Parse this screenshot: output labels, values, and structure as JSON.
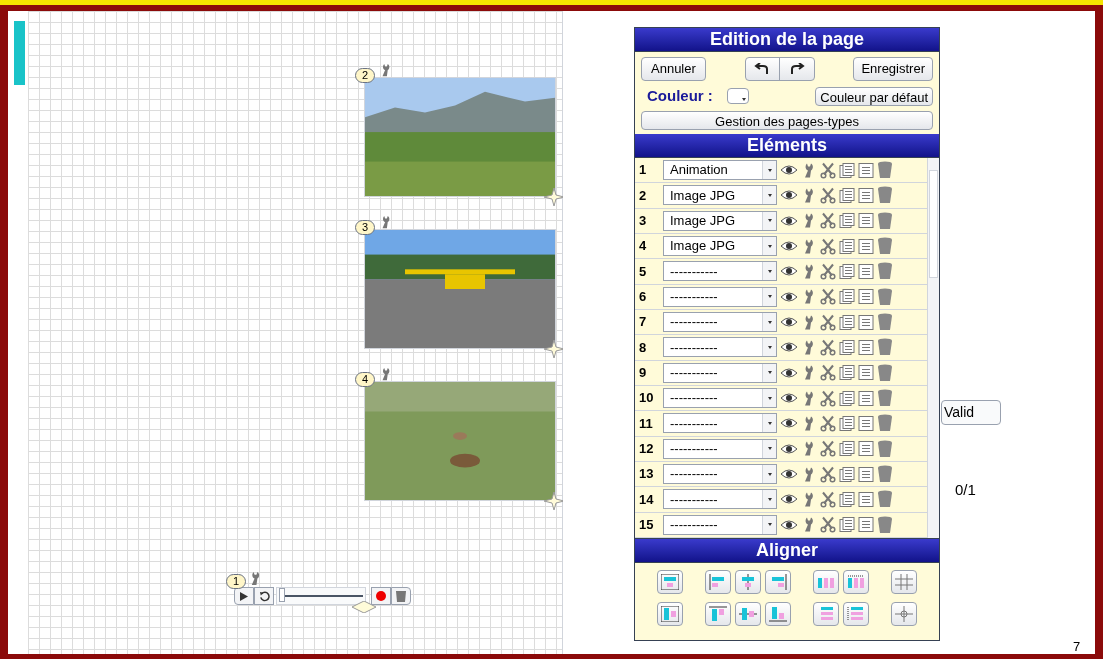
{
  "canvas": {
    "images": [
      {
        "badge": "2",
        "kind": "mountains"
      },
      {
        "badge": "3",
        "kind": "plane"
      },
      {
        "badge": "4",
        "kind": "bears"
      }
    ],
    "animation": {
      "badge": "1",
      "level": 0
    }
  },
  "panel": {
    "title": "Edition de la page",
    "cancel": "Annuler",
    "save": "Enregistrer",
    "color_label": "Couleur :",
    "default_color": "Couleur par défaut",
    "templates": "Gestion des pages-types",
    "elements_title": "Eléments",
    "elements": [
      {
        "number": "1",
        "type": "Animation"
      },
      {
        "number": "2",
        "type": "Image JPG"
      },
      {
        "number": "3",
        "type": "Image JPG"
      },
      {
        "number": "4",
        "type": "Image JPG"
      },
      {
        "number": "5",
        "type": "-----------"
      },
      {
        "number": "6",
        "type": "-----------"
      },
      {
        "number": "7",
        "type": "-----------"
      },
      {
        "number": "8",
        "type": "-----------"
      },
      {
        "number": "9",
        "type": "-----------"
      },
      {
        "number": "10",
        "type": "-----------"
      },
      {
        "number": "11",
        "type": "-----------"
      },
      {
        "number": "12",
        "type": "-----------"
      },
      {
        "number": "13",
        "type": "-----------"
      },
      {
        "number": "14",
        "type": "-----------"
      },
      {
        "number": "15",
        "type": "-----------"
      }
    ],
    "align_title": "Aligner"
  },
  "valid_button": "Valid",
  "score": "0/1",
  "page_number": "7"
}
